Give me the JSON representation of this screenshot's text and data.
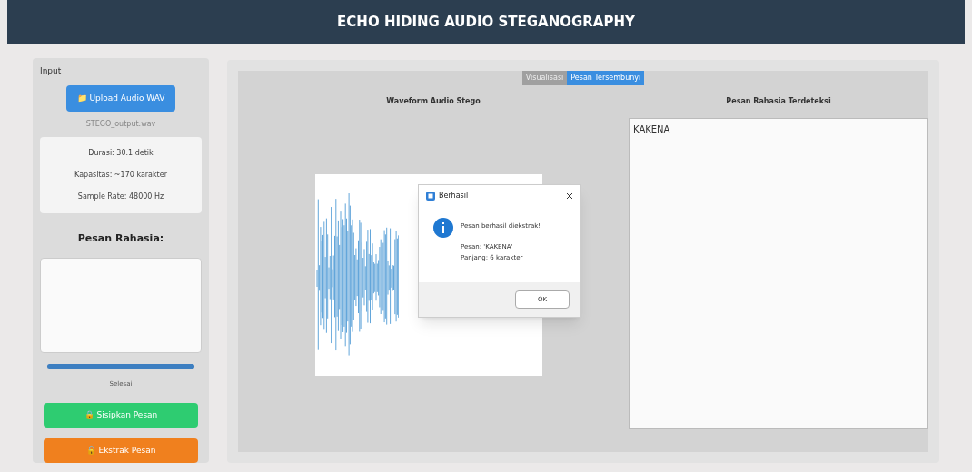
{
  "header": {
    "title": "ECHO HIDING AUDIO STEGANOGRAPHY"
  },
  "input_panel": {
    "title": "Input",
    "upload_button": "📁 Upload Audio WAV",
    "file_name": "STEGO_output.wav",
    "info": [
      "Durasi: 30.1 detik",
      "Kapasitas: ~170 karakter",
      "Sample Rate: 48000 Hz"
    ],
    "message_label": "Pesan Rahasia:",
    "progress": {
      "level": 1
    },
    "status": "Selesai",
    "buttons": [
      {
        "label": "🔒 Sisipkan Pesan",
        "kind": "embed"
      },
      {
        "label": "🔓 Ekstrak Pesan",
        "kind": "extract"
      }
    ]
  },
  "tabs": [
    {
      "label": "Visualisasi",
      "selected": false
    },
    {
      "label": "Pesan Tersembunyi",
      "selected": true
    }
  ],
  "waveform": {
    "title": "Waveform Audio Stego"
  },
  "extracted": {
    "title": "Pesan Rahasia Terdeteksi",
    "value": "KAKENA"
  },
  "dialog": {
    "title": "Berhasil",
    "message": "Pesan berhasil diekstrak!",
    "details": [
      "Pesan: 'KAKENA'",
      "Panjang: 6 karakter"
    ],
    "button": "OK"
  }
}
